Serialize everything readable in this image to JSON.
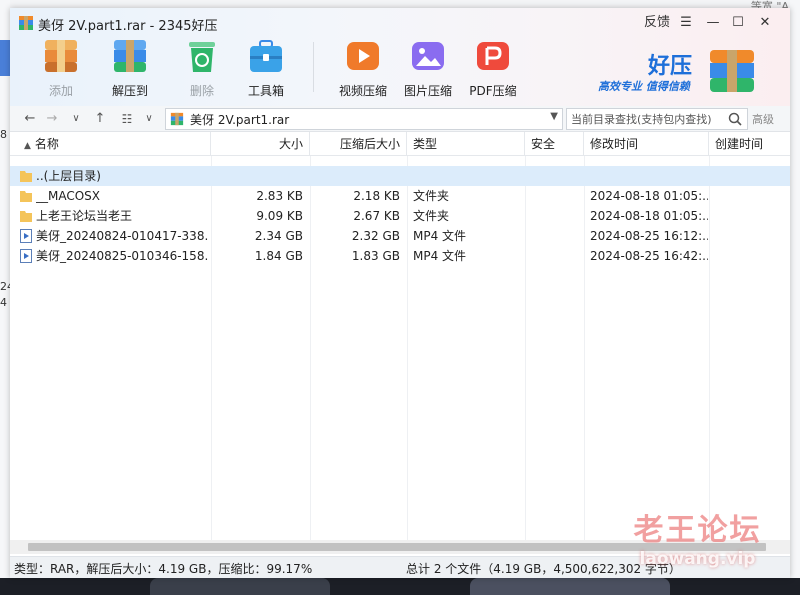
{
  "desktop": {
    "left_texts": [
      "8",
      "24",
      "4"
    ],
    "right_text": "等宽 \"A\""
  },
  "window": {
    "title": "美伢 2V.part1.rar - 2345好压",
    "controls": {
      "feedback": "反馈",
      "menu": "☰",
      "minimize": "—",
      "maximize": "☐",
      "close": "✕"
    }
  },
  "toolbar": [
    {
      "name": "add",
      "label": "添加",
      "icon": "archive-add-icon",
      "disabled": true,
      "color": "#e98b3b"
    },
    {
      "name": "extract",
      "label": "解压到",
      "icon": "archive-extract-icon",
      "disabled": false,
      "color": "#3a8be8"
    },
    {
      "name": "delete",
      "label": "删除",
      "icon": "recycle-icon",
      "disabled": true,
      "color": "#2fb56a"
    },
    {
      "name": "toolbox",
      "label": "工具箱",
      "icon": "toolbox-icon",
      "disabled": false,
      "color": "#3aa2e8"
    },
    {
      "name": "video-compress",
      "label": "视频压缩",
      "icon": "video-icon",
      "disabled": false,
      "color": "#f07a2a"
    },
    {
      "name": "image-compress",
      "label": "图片压缩",
      "icon": "image-icon",
      "disabled": false,
      "color": "#8a6cf0"
    },
    {
      "name": "pdf-compress",
      "label": "PDF压缩",
      "icon": "pdf-icon",
      "disabled": false,
      "color": "#ef4a3c"
    }
  ],
  "brand": {
    "name": "好压",
    "slogan": "高效专业  值得信赖",
    "color": "#1e6fd9"
  },
  "address": {
    "path": "美伢 2V.part1.rar",
    "search_placeholder": "当前目录查找(支持包内查找)",
    "advanced": "高级"
  },
  "columns": [
    "名称",
    "大小",
    "压缩后大小",
    "类型",
    "安全",
    "修改时间",
    "创建时间"
  ],
  "files": [
    {
      "name": "..(上层目录)",
      "size": "",
      "packed": "",
      "type": "",
      "modified": "",
      "kind": "folder",
      "selected": true
    },
    {
      "name": "__MACOSX",
      "size": "2.83 KB",
      "packed": "2.18 KB",
      "type": "文件夹",
      "modified": "2024-08-18 01:05:...",
      "kind": "folder",
      "selected": false
    },
    {
      "name": "上老王论坛当老王",
      "size": "9.09 KB",
      "packed": "2.67 KB",
      "type": "文件夹",
      "modified": "2024-08-18 01:05:...",
      "kind": "folder",
      "selected": false
    },
    {
      "name": "美伢_20240824-010417-338....",
      "size": "2.34 GB",
      "packed": "2.32 GB",
      "type": "MP4 文件",
      "modified": "2024-08-25 16:12:...",
      "kind": "video",
      "selected": false
    },
    {
      "name": "美伢_20240825-010346-158....",
      "size": "1.84 GB",
      "packed": "1.83 GB",
      "type": "MP4 文件",
      "modified": "2024-08-25 16:42:...",
      "kind": "video",
      "selected": false
    }
  ],
  "status": {
    "left": "类型：RAR，解压后大小：4.19 GB，压缩比：99.17%",
    "right": "总计 2 个文件（4.19 GB，4,500,622,302 字节）"
  },
  "watermark": {
    "cn": "老王论坛",
    "en": "laowang.vip"
  }
}
